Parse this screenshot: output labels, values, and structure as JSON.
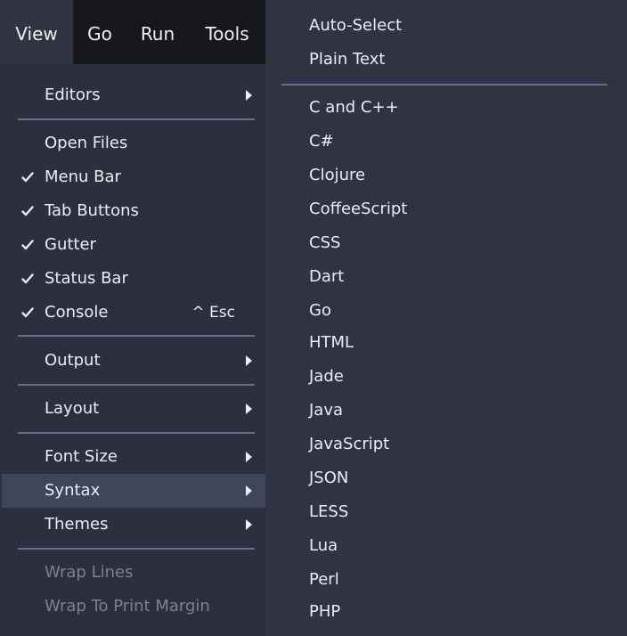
{
  "menubar": {
    "view": "View",
    "go": "Go",
    "run": "Run",
    "tools": "Tools"
  },
  "view_menu": {
    "editors": "Editors",
    "open_files": "Open Files",
    "menu_bar": "Menu Bar",
    "tab_buttons": "Tab Buttons",
    "gutter": "Gutter",
    "status_bar": "Status Bar",
    "console": "Console",
    "console_shortcut": "^ Esc",
    "output": "Output",
    "layout": "Layout",
    "font_size": "Font Size",
    "syntax": "Syntax",
    "themes": "Themes",
    "wrap_lines": "Wrap Lines",
    "wrap_to_print_margin": "Wrap To Print Margin"
  },
  "syntax_menu": {
    "auto_select": "Auto-Select",
    "plain_text": "Plain Text",
    "languages": [
      "C and C++",
      "C#",
      "Clojure",
      "CoffeeScript",
      "CSS",
      "Dart",
      "Go",
      "HTML",
      "Jade",
      "Java",
      "JavaScript",
      "JSON",
      "LESS",
      "Lua",
      "Perl",
      "PHP"
    ]
  },
  "colors": {
    "menu_bg": "#2c303e",
    "submenu_bg": "#2f3342",
    "highlight": "#404659",
    "separator": "#5f6f8e",
    "text": "#eaedf2",
    "disabled_text": "#7c8190"
  }
}
